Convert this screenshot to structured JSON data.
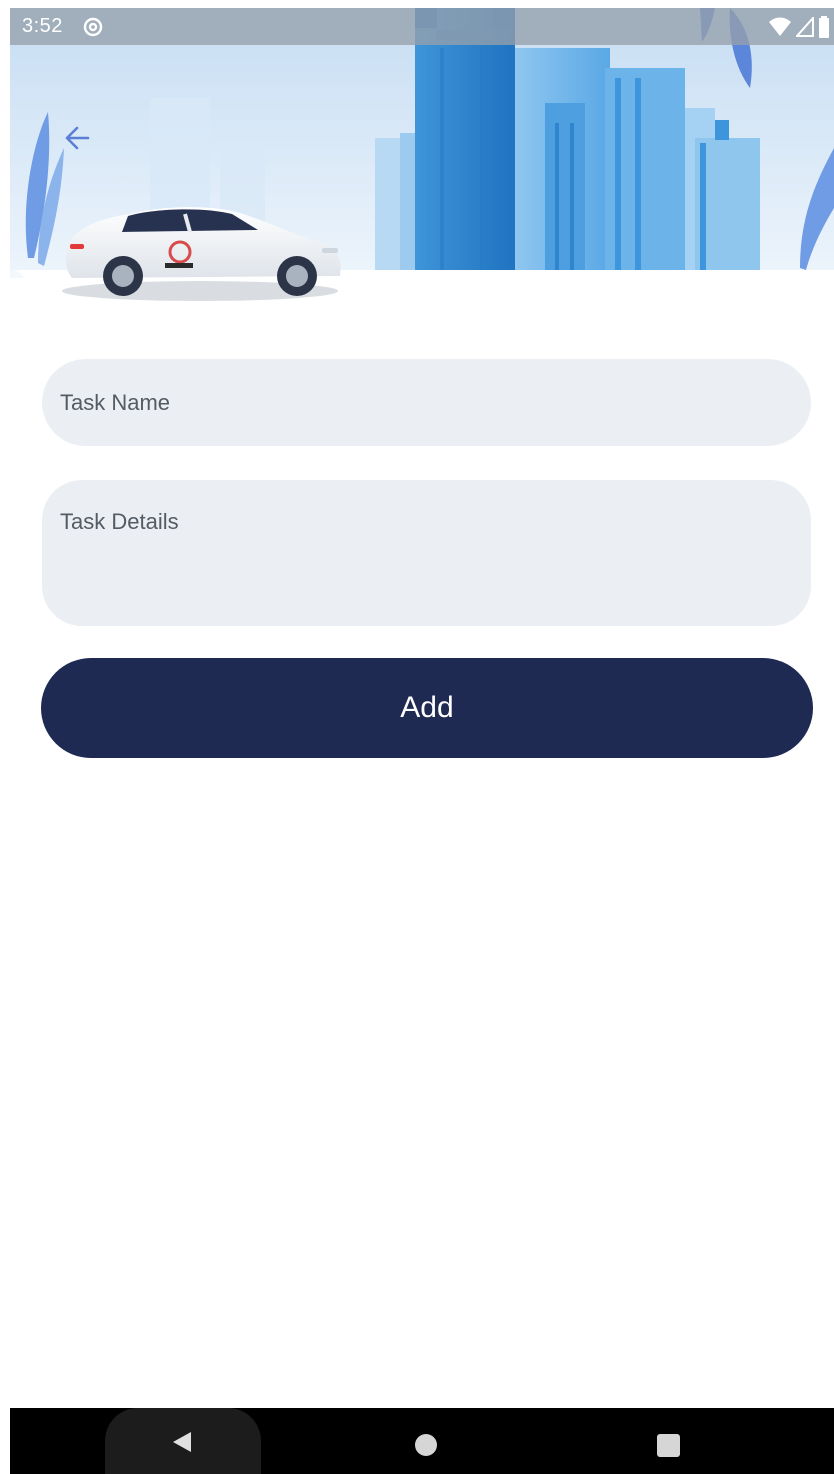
{
  "status_bar": {
    "time": "3:52",
    "notification_icon": "at-sign-icon",
    "wifi_icon": "wifi-icon",
    "signal_icon": "cell-signal-icon",
    "battery_icon": "battery-icon"
  },
  "header": {
    "back_icon": "arrow-left-icon",
    "illustration_icon": "taxi-city-illustration",
    "accent_color": "#5b7fd6"
  },
  "form": {
    "task_name": {
      "value": "",
      "placeholder": "Task Name"
    },
    "task_details": {
      "value": "",
      "placeholder": "Task Details"
    },
    "add_label": "Add",
    "button_color": "#1f2a52",
    "field_color": "#ebeff4"
  },
  "nav_bar": {
    "back_icon": "triangle-back-icon",
    "home_icon": "circle-home-icon",
    "recents_icon": "square-recents-icon"
  }
}
